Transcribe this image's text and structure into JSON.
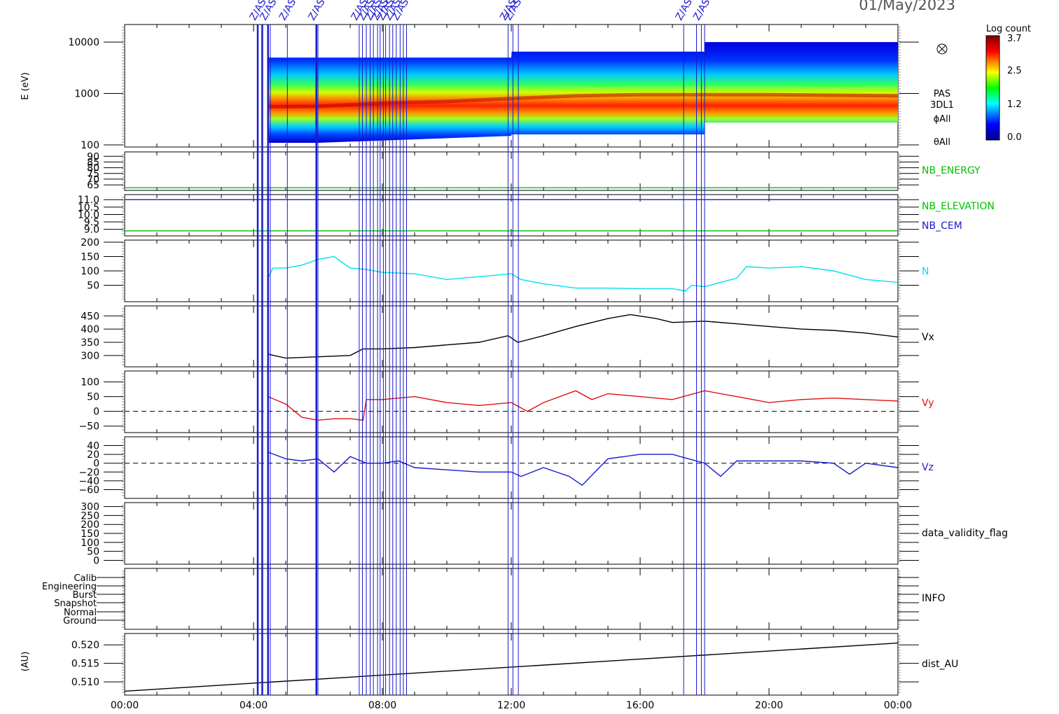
{
  "date_title": "01/May/2023",
  "event_marker_label": "Z/AS",
  "event_times_h": [
    4.13,
    4.27,
    4.45,
    4.52,
    5.05,
    5.95,
    6.0,
    7.28,
    7.38,
    7.5,
    7.62,
    7.72,
    7.85,
    7.93,
    8.03,
    8.1,
    8.22,
    8.32,
    8.43,
    8.55,
    8.65,
    8.75,
    11.9,
    12.05,
    12.22,
    17.35,
    17.75,
    17.9,
    18.0
  ],
  "colorbar": {
    "title": "Log count",
    "ticks": [
      "3.7",
      "2.5",
      "1.2",
      "0.0"
    ],
    "max": 3.7
  },
  "time_axis": {
    "ticks": [
      "00:00",
      "04:00",
      "08:00",
      "12:00",
      "16:00",
      "20:00",
      "00:00"
    ],
    "range_h": [
      0,
      24
    ]
  },
  "chart_data": [
    {
      "type": "heatmap",
      "panel": "spectrogram",
      "ylabel": "E (eV)",
      "yscale": "log",
      "ylim": [
        100,
        20000
      ],
      "yticks": [
        "10000",
        "1000",
        "100"
      ],
      "right_labels": [
        "PAS",
        "3DL1",
        "ϕAll",
        "θAll"
      ],
      "x_range_h": [
        4.45,
        24
      ],
      "peak_energy_eV": [
        [
          4.45,
          550
        ],
        [
          6,
          560
        ],
        [
          8,
          650
        ],
        [
          10,
          700
        ],
        [
          12,
          800
        ],
        [
          14,
          900
        ],
        [
          16,
          950
        ],
        [
          18,
          950
        ],
        [
          20,
          950
        ],
        [
          24,
          900
        ]
      ],
      "upper_edge_eV": [
        [
          4.45,
          5000
        ],
        [
          12,
          5000
        ],
        [
          12.01,
          6500
        ],
        [
          18,
          6500
        ],
        [
          18.01,
          10000
        ],
        [
          24,
          10000
        ]
      ],
      "lower_edge_eV": [
        [
          4.45,
          110
        ],
        [
          6,
          110
        ],
        [
          12,
          150
        ],
        [
          12.01,
          160
        ],
        [
          18,
          160
        ],
        [
          18.01,
          270
        ],
        [
          24,
          270
        ]
      ]
    },
    {
      "type": "line",
      "panel": "nb_energy",
      "ylim": [
        62,
        92
      ],
      "yticks": [
        "90",
        "85",
        "80",
        "75",
        "70",
        "65"
      ],
      "series": [
        {
          "name": "NB_ENERGY",
          "color": "#00c000",
          "x": [
            0,
            24
          ],
          "y": [
            62.5,
            62.5
          ]
        }
      ]
    },
    {
      "type": "line",
      "panel": "nb_elevation",
      "ylim": [
        8.7,
        11.2
      ],
      "yticks": [
        "11.0",
        "10.5",
        "10.0",
        "9.5",
        "9.0"
      ],
      "series": [
        {
          "name": "NB_ELEVATION",
          "color": "#00c000",
          "x": [
            0,
            24
          ],
          "y": [
            8.9,
            8.9
          ]
        },
        {
          "name": "NB_CEM",
          "color": "#1a1acc",
          "x": [
            0,
            24
          ],
          "y": [
            11.0,
            11.0
          ]
        }
      ]
    },
    {
      "type": "line",
      "panel": "density",
      "ylim": [
        0,
        200
      ],
      "yticks": [
        "200",
        "150",
        "100",
        "50"
      ],
      "series": [
        {
          "name": "N",
          "color": "#00e0f0",
          "x": [
            4.45,
            4.6,
            5.0,
            5.5,
            6.0,
            6.5,
            7.0,
            7.5,
            8.0,
            9.0,
            10.0,
            11.0,
            12.0,
            12.3,
            13.0,
            14.0,
            15.0,
            16.0,
            17.0,
            17.4,
            17.6,
            18.0,
            18.5,
            19.0,
            19.3,
            20.0,
            21.0,
            22.0,
            23.0,
            24.0
          ],
          "y": [
            75,
            110,
            110,
            120,
            140,
            150,
            110,
            105,
            95,
            90,
            70,
            80,
            90,
            70,
            55,
            40,
            40,
            38,
            38,
            30,
            50,
            45,
            60,
            75,
            115,
            110,
            115,
            100,
            70,
            60
          ]
        }
      ]
    },
    {
      "type": "line",
      "panel": "vx",
      "ylim": [
        265,
        480
      ],
      "yticks": [
        "450",
        "400",
        "350",
        "300"
      ],
      "series": [
        {
          "name": "Vx",
          "color": "#000000",
          "x": [
            4.45,
            5.0,
            6.0,
            7.0,
            7.4,
            8.0,
            9.0,
            10.0,
            11.0,
            11.9,
            12.2,
            13.0,
            14.0,
            15.0,
            15.7,
            16.5,
            17.0,
            18.0,
            19.0,
            20.0,
            21.0,
            22.0,
            23.0,
            24.0
          ],
          "y": [
            305,
            290,
            295,
            300,
            325,
            325,
            330,
            340,
            350,
            375,
            350,
            375,
            410,
            440,
            455,
            440,
            425,
            430,
            420,
            410,
            400,
            395,
            385,
            370
          ]
        }
      ]
    },
    {
      "type": "line",
      "panel": "vy",
      "ylim": [
        -65,
        130
      ],
      "yticks": [
        "100",
        "50",
        "0",
        "−50"
      ],
      "series": [
        {
          "name": "Vy",
          "color": "#e01010",
          "x": [
            4.45,
            5.0,
            5.5,
            6.0,
            6.5,
            7.0,
            7.4,
            7.5,
            8.0,
            9.0,
            10.0,
            11.0,
            12.0,
            12.5,
            13.0,
            14.0,
            14.5,
            15.0,
            16.0,
            17.0,
            18.0,
            19.0,
            20.0,
            21.0,
            22.0,
            23.0,
            24.0
          ],
          "y": [
            50,
            25,
            -20,
            -30,
            -25,
            -25,
            -30,
            40,
            40,
            50,
            30,
            20,
            30,
            0,
            30,
            70,
            40,
            60,
            50,
            40,
            70,
            50,
            30,
            40,
            45,
            40,
            35
          ]
        }
      ]
    },
    {
      "type": "line",
      "panel": "vz",
      "ylim": [
        -75,
        55
      ],
      "yticks": [
        "40",
        "20",
        "0",
        "−20",
        "−40",
        "−60"
      ],
      "series": [
        {
          "name": "Vz",
          "color": "#1a1acc",
          "x": [
            4.45,
            5.0,
            5.5,
            6.0,
            6.5,
            7.0,
            7.5,
            8.0,
            8.5,
            9.0,
            10.0,
            11.0,
            12.0,
            12.3,
            13.0,
            13.8,
            14.2,
            14.6,
            15.0,
            16.0,
            17.0,
            17.5,
            18.0,
            18.5,
            19.0,
            20.0,
            21.0,
            22.0,
            22.5,
            23.0,
            24.0
          ],
          "y": [
            25,
            10,
            5,
            10,
            -20,
            15,
            0,
            0,
            5,
            -10,
            -15,
            -20,
            -20,
            -30,
            -10,
            -30,
            -50,
            -20,
            10,
            20,
            20,
            10,
            0,
            -30,
            5,
            5,
            5,
            0,
            -25,
            0,
            -10
          ]
        }
      ]
    },
    {
      "type": "line",
      "panel": "data_validity",
      "ylim": [
        -10,
        310
      ],
      "yticks": [
        "300",
        "250",
        "200",
        "150",
        "100",
        "50",
        "0"
      ],
      "series": [
        {
          "name": "data_validity_flag",
          "color": "#000000",
          "x": [],
          "y": []
        }
      ]
    },
    {
      "type": "line",
      "panel": "info",
      "ylim": [
        0,
        6
      ],
      "yticks": [
        "Calib",
        "Engineering",
        "Burst",
        "Snapshot",
        "Normal",
        "Ground"
      ],
      "series": [
        {
          "name": "INFO",
          "color": "#000000",
          "x": [],
          "y": []
        }
      ]
    },
    {
      "type": "line",
      "panel": "dist",
      "ylabel": "(AU)",
      "ylim": [
        0.507,
        0.5225
      ],
      "yticks": [
        "0.520",
        "0.515",
        "0.510"
      ],
      "series": [
        {
          "name": "dist_AU",
          "color": "#000000",
          "x": [
            0,
            24
          ],
          "y": [
            0.5075,
            0.5205
          ]
        }
      ]
    }
  ]
}
